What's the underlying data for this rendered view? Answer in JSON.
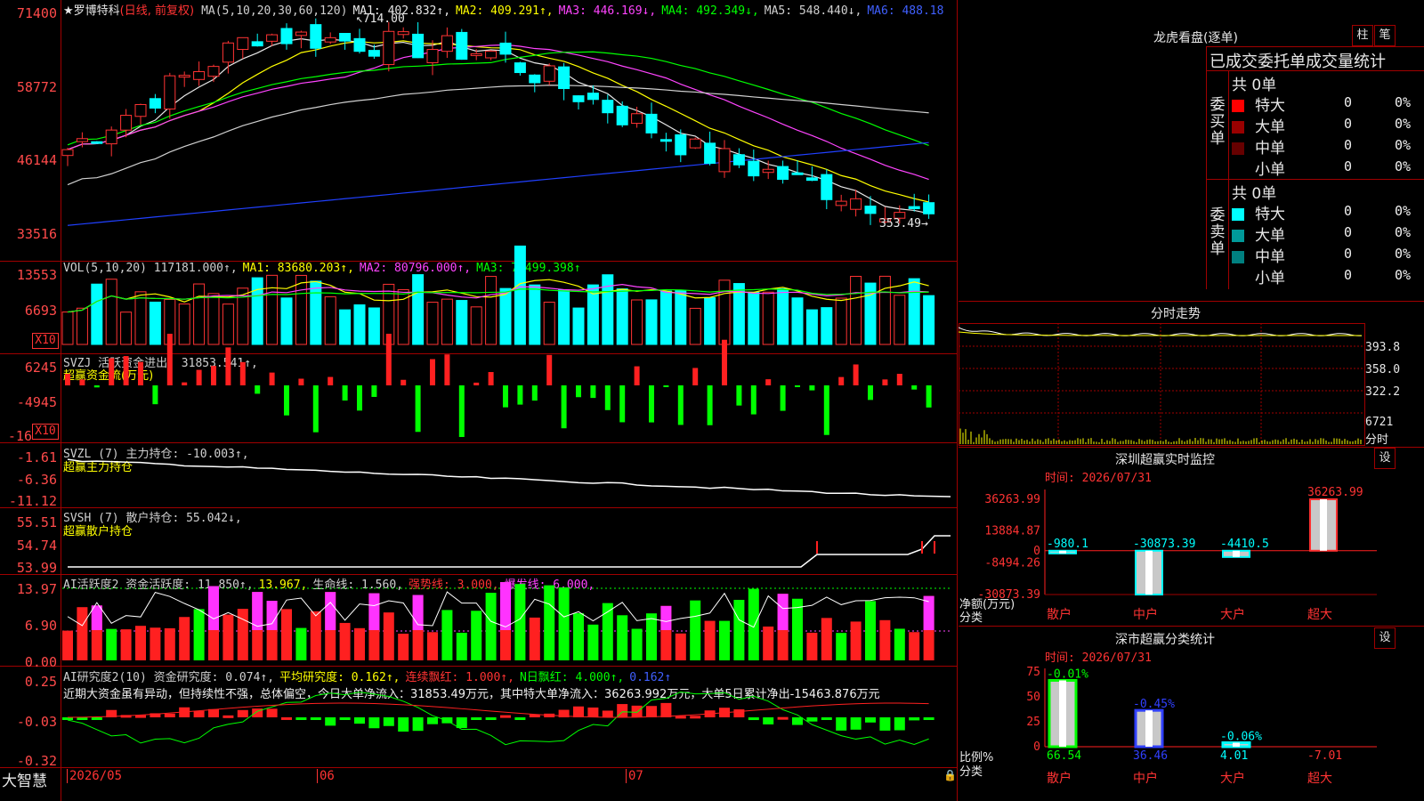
{
  "stock": {
    "name": "★罗博特科",
    "mode": "(日线, 前复权)"
  },
  "main_panel": {
    "ma_header": [
      {
        "text": "MA(5,10,20,30,60,120)",
        "color": "#d0d0d0"
      },
      {
        "text": "MA1: 402.832↑,",
        "color": "#e8e8e8"
      },
      {
        "text": "MA2: 409.291↑,",
        "color": "#ffff00"
      },
      {
        "text": "MA3: 446.169↓,",
        "color": "#ff44ff"
      },
      {
        "text": "MA4: 492.349↓,",
        "color": "#00ff00"
      },
      {
        "text": "MA5: 548.440↓,",
        "color": "#d0d0d0"
      },
      {
        "text": "MA6: 488.18",
        "color": "#4060ff"
      }
    ],
    "y_ticks": [
      "71400",
      "58772",
      "46144",
      "33516"
    ],
    "high_label": "714.00",
    "low_label": "353.49"
  },
  "vol_panel": {
    "header": [
      {
        "text": "VOL(5,10,20) 117181.000↑,",
        "color": "#d0d0d0"
      },
      {
        "text": "MA1: 83680.203↑,",
        "color": "#ffff00"
      },
      {
        "text": "MA2: 80796.000↑,",
        "color": "#ff44ff"
      },
      {
        "text": "MA3: 70499.398↑",
        "color": "#00ff00"
      }
    ],
    "y_ticks": [
      "13553",
      "6693"
    ],
    "unit": "X10"
  },
  "svzj_panel": {
    "header": "SVZJ  活跃资金进出: 31853.541↑,",
    "subtitle": "超赢资金流(万元)",
    "y_ticks": [
      "6245",
      "-4945",
      "-16"
    ],
    "unit": "X10"
  },
  "svzl_panel": {
    "header": "SVZL (7) 主力持仓: -10.003↑,",
    "subtitle": "超赢主力持仓",
    "y_ticks": [
      "-1.61",
      "-6.36",
      "-11.12"
    ]
  },
  "svsh_panel": {
    "header": "SVSH (7) 散户持仓: 55.042↓,",
    "subtitle": "超赢散户持仓",
    "y_ticks": [
      "55.51",
      "54.74",
      "53.99"
    ]
  },
  "ai_active_panel": {
    "header": [
      {
        "text": "AI活跃度2 资金活跃度: 11.850↑,",
        "color": "#d0d0d0"
      },
      {
        "text": "13.967,",
        "color": "#ffff00"
      },
      {
        "text": "生命线: 1.560,",
        "color": "#d0d0d0"
      },
      {
        "text": "强势线: 3.000,",
        "color": "#ff3333"
      },
      {
        "text": "爆发线: 6.000,",
        "color": "#ff44ff"
      }
    ],
    "y_ticks": [
      "13.97",
      "6.90",
      "0.00"
    ]
  },
  "ai_research_panel": {
    "header": [
      {
        "text": "AI研究度2(10) 资金研究度: 0.074↑,",
        "color": "#d0d0d0"
      },
      {
        "text": "平均研究度: 0.162↑,",
        "color": "#ffff00"
      },
      {
        "text": "连续飘红: 1.000↑,",
        "color": "#ff3333"
      },
      {
        "text": "N日飘红: 4.000↑,",
        "color": "#00ff00"
      },
      {
        "text": "0.162↑",
        "color": "#4060ff"
      }
    ],
    "commentary": "近期大资金虽有异动，但持续性不强，总体偏空，今日大单净流入：31853.49万元，其中特大单净流入：36263.992万元，大单5日累计净出-15463.876万元",
    "y_ticks": [
      "0.25",
      "-0.03",
      "-0.32"
    ]
  },
  "footer": {
    "brand": "大智慧",
    "dates": [
      "2026/05",
      "06",
      "07"
    ]
  },
  "dragon_tiger": {
    "title": "龙虎看盘(逐单)",
    "btn_bar": "柱",
    "btn_pen": "笔",
    "table_title": "已成交委托单成交量统计",
    "buy_label": "委买单",
    "sell_label": "委卖单",
    "buy_total": "共 0单",
    "sell_total": "共 0单",
    "buy_rows": [
      {
        "label": "特大",
        "count": "0",
        "pct": "0%",
        "color": "#ff0000"
      },
      {
        "label": "大单",
        "count": "0",
        "pct": "0%",
        "color": "#990000"
      },
      {
        "label": "中单",
        "count": "0",
        "pct": "0%",
        "color": "#660000"
      },
      {
        "label": "小单",
        "count": "0",
        "pct": "0%",
        "color": ""
      }
    ],
    "sell_rows": [
      {
        "label": "特大",
        "count": "0",
        "pct": "0%",
        "color": "#00ffff"
      },
      {
        "label": "大单",
        "count": "0",
        "pct": "0%",
        "color": "#009999"
      },
      {
        "label": "中单",
        "count": "0",
        "pct": "0%",
        "color": "#008080"
      },
      {
        "label": "小单",
        "count": "0",
        "pct": "0%",
        "color": ""
      }
    ]
  },
  "intraday": {
    "title": "分时走势",
    "y_ticks": [
      "393.8",
      "358.0",
      "322.2"
    ],
    "vol_tick": "6721",
    "vol_unit": "分时"
  },
  "sz_monitor": {
    "title": "深圳超赢实时监控",
    "btn": "设",
    "time": "时间: 2026/07/31",
    "y_ticks": [
      "36263.99",
      "13884.87",
      "0",
      "-8494.26",
      "-30873.39"
    ],
    "y_label": "净额(万元)",
    "x_label": "分类",
    "categories": [
      "散户",
      "中户",
      "大户",
      "超大"
    ],
    "values": [
      -980.1,
      -30873.39,
      -4410.5,
      36263.99
    ],
    "value_labels": [
      "-980.1",
      "-30873.39",
      "-4410.5",
      "36263.99"
    ]
  },
  "sz_category": {
    "title": "深市超赢分类统计",
    "btn": "设",
    "time": "时间: 2026/07/31",
    "y_ticks": [
      "75",
      "50",
      "25",
      "0"
    ],
    "y_label": "比例%",
    "x_label": "分类",
    "categories": [
      "散户",
      "中户",
      "大户",
      "超大"
    ],
    "top_labels": [
      "-0.01%",
      "-0.45%",
      "-0.06%",
      ""
    ],
    "bottom_labels": [
      "66.54",
      "36.46",
      "4.01",
      "-7.01"
    ],
    "values": [
      66.54,
      36.46,
      4.01,
      -7.01
    ]
  },
  "chart_data": [
    {
      "type": "line",
      "title": "",
      "note": "Stand-in daily OHLC candlestick chart with moving averages (visual approximation of the screenshot). There are no readable per-bar values: the candle values are not recorded; only the high and low are printed.",
      "series": [
        {
          "name": "",
          "values": []
        }
      ]
    },
    {
      "type": "bar",
      "title": "深圳超赢实时监控",
      "xlabel": "分类",
      "ylabel": "净额(万元)",
      "categories": [
        "散户",
        "中户",
        "大户",
        "超大"
      ],
      "values": [
        -980.1,
        -30873.39,
        -4410.5,
        36263.99
      ],
      "ylim": [
        -30873.39,
        36263.99
      ]
    },
    {
      "type": "bar",
      "title": "深市超赢分类统计",
      "xlabel": "分类",
      "ylabel": "比例%",
      "categories": [
        "散户",
        "中户",
        "大户",
        "超大"
      ],
      "values": [
        66.54,
        36.46,
        4.01,
        -7.01
      ],
      "ylim": [
        0,
        75
      ]
    }
  ]
}
